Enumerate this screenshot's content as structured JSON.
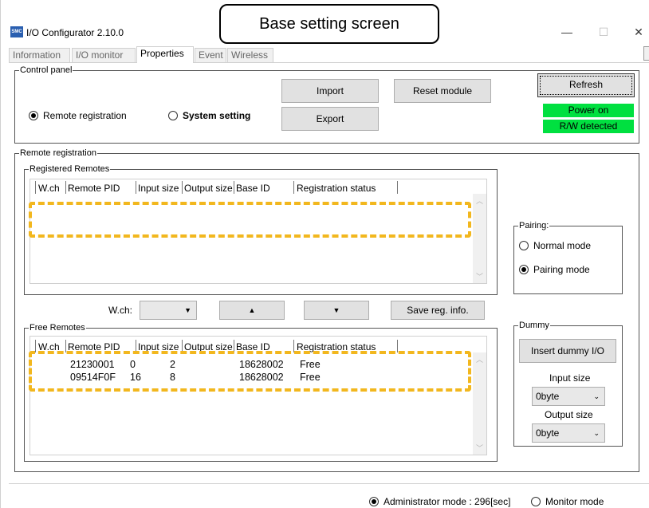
{
  "callout": "Base setting screen",
  "window": {
    "title": "I/O Configurator 2.10.0",
    "logo": "SMC",
    "minimize": "—",
    "maximize": "☐",
    "close": "✕"
  },
  "tabs": [
    "Information",
    "I/O monitor",
    "Properties",
    "Event",
    "Wireless"
  ],
  "active_tab": "Properties",
  "control_panel": {
    "legend": "Control panel",
    "radio_remote": "Remote registration",
    "radio_system": "System setting",
    "import": "Import",
    "export": "Export",
    "reset": "Reset module",
    "refresh": "Refresh",
    "power": "Power on",
    "rw": "R/W detected"
  },
  "remote_registration": {
    "legend": "Remote registration",
    "registered": {
      "legend": "Registered Remotes",
      "columns": [
        "W.ch",
        "Remote PID",
        "Input size",
        "Output size",
        "Base ID",
        "Registration status"
      ],
      "rows": []
    },
    "free": {
      "legend": "Free Remotes",
      "columns": [
        "W.ch",
        "Remote PID",
        "Input size",
        "Output size",
        "Base ID",
        "Registration status"
      ],
      "rows": [
        [
          "",
          "21230001",
          "0",
          "2",
          "18628002",
          "Free"
        ],
        [
          "",
          "09514F0F",
          "16",
          "8",
          "18628002",
          "Free"
        ]
      ]
    },
    "wch_label": "W.ch:",
    "up": "▲",
    "down": "▼",
    "save": "Save reg. info.",
    "pairing": {
      "legend": "Pairing:",
      "normal": "Normal mode",
      "pairing": "Pairing mode"
    },
    "dummy": {
      "legend": "Dummy",
      "insert": "Insert dummy I/O",
      "input_label": "Input size",
      "input_value": "0byte",
      "output_label": "Output size",
      "output_value": "0byte"
    }
  },
  "statusbar": {
    "admin": "Administrator mode : 296[sec]",
    "monitor": "Monitor mode"
  },
  "colors": {
    "status_green": "#00e040",
    "highlight": "#f2b71e"
  }
}
